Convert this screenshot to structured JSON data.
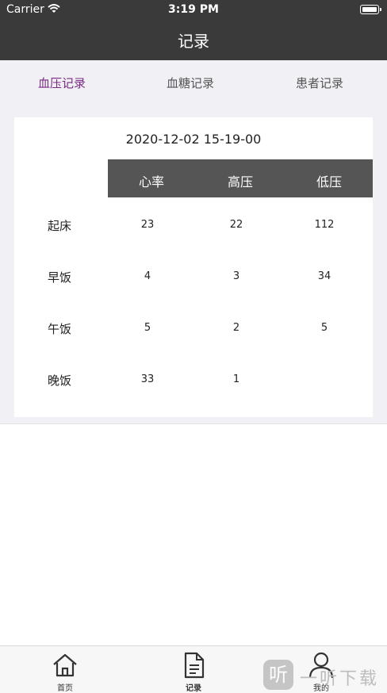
{
  "status_bar": {
    "carrier": "Carrier",
    "time": "3:19 PM"
  },
  "nav": {
    "title": "记录"
  },
  "tabs": [
    {
      "label": "血压记录",
      "active": true
    },
    {
      "label": "血糖记录",
      "active": false
    },
    {
      "label": "患者记录",
      "active": false
    }
  ],
  "record": {
    "datetime": "2020-12-02 15-19-00",
    "headers": [
      "心率",
      "高压",
      "低压"
    ],
    "rows": [
      {
        "label": "起床",
        "values": [
          "23",
          "22",
          "112"
        ]
      },
      {
        "label": "早饭",
        "values": [
          "4",
          "3",
          "34"
        ]
      },
      {
        "label": "午饭",
        "values": [
          "5",
          "2",
          "5"
        ]
      },
      {
        "label": "晚饭",
        "values": [
          "33",
          "1",
          ""
        ]
      }
    ]
  },
  "tab_bar": [
    {
      "label": "首页",
      "icon": "home-icon"
    },
    {
      "label": "记录",
      "icon": "document-icon"
    },
    {
      "label": "我的",
      "icon": "user-icon"
    }
  ],
  "watermark": {
    "logo": "听",
    "text": "一听下载"
  },
  "colors": {
    "header_bg": "#3a3a3a",
    "active_tab": "#7a2a82",
    "table_header": "#555555",
    "page_bg": "#f1f0f5"
  }
}
